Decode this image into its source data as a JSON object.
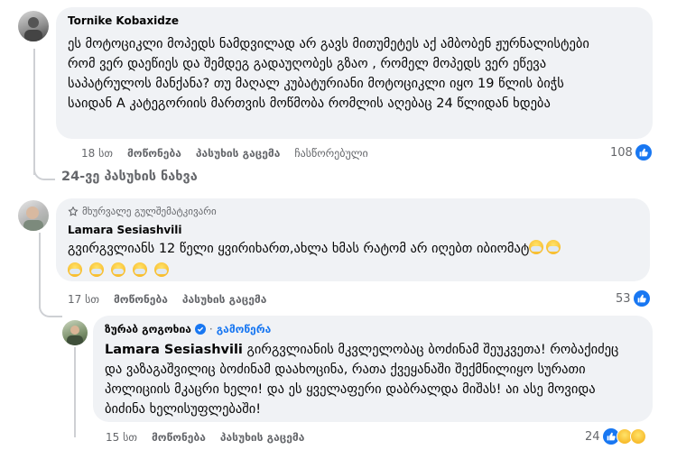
{
  "comments": [
    {
      "author": "Tornike Kobaxidze",
      "text": "ეს მოტოციკლი მოპედს ნამდვილად არ გავს მითუმეტეს აქ ამბობენ ჟურნალისტები რომ ვერ დაეწიეს და შემდეგ გადაუღობეს გზაო , რომელ მოპედს ვერ ეწევა საპატრულოს მანქანა? თუ მაღალ კუბატურიანი მოტოციკლი იყო 19 წლის ბიჭს საიდან A კატეგორიის მართვის მოწმობა რომლის აღებაც 24 წლიდან ხდება",
      "time": "18 სთ",
      "like": "მოწონება",
      "reply": "პასუხის გაცემა",
      "edited": "ჩასწორებული",
      "reactions": "108"
    },
    {
      "top_fan": "მხურვალე გულშემატკივარი",
      "author": "Lamara Sesiashvili",
      "text_line1": "გვირგვლიანს 12 წელი ყვირიხართ,ახლა ხმას რატომ არ იღებთ იბიომატ",
      "time": "17 სთ",
      "like": "მოწონება",
      "reply": "პასუხის გაცემა",
      "reactions": "53"
    },
    {
      "author": "ზურაბ გოგოხია",
      "follow": "გამოწერა",
      "mention": "Lamara Sesiashvili",
      "text": " გირგვლიანის მკვლელობაც ბოძინამ შეუკვეთა! რობაქიძეც და ვაზაგაშვილიც ბოძინამ დაახოცინა, რათა ქვეყანაში შექმნილიყო სურათი პოლიციის მკაცრი ხელი! და ეს ყველაფერი დაბრალდა მიშას! აი ასე მოვიდა ბიძინა ხელისუფლებაში!",
      "time": "15 სთ",
      "like": "მოწონება",
      "reply": "პასუხის გაცემა",
      "reactions": "24"
    }
  ],
  "view_replies": "24-ვე პასუხის ნახვა",
  "colors": {
    "bubble": "#f0f2f5",
    "like_blue": "#1877f2",
    "meta_gray": "#65676b"
  },
  "icons": [
    "like-icon",
    "haha-icon",
    "sad-icon",
    "face-mask-emoji",
    "top-fan-badge-icon",
    "verified-icon"
  ]
}
